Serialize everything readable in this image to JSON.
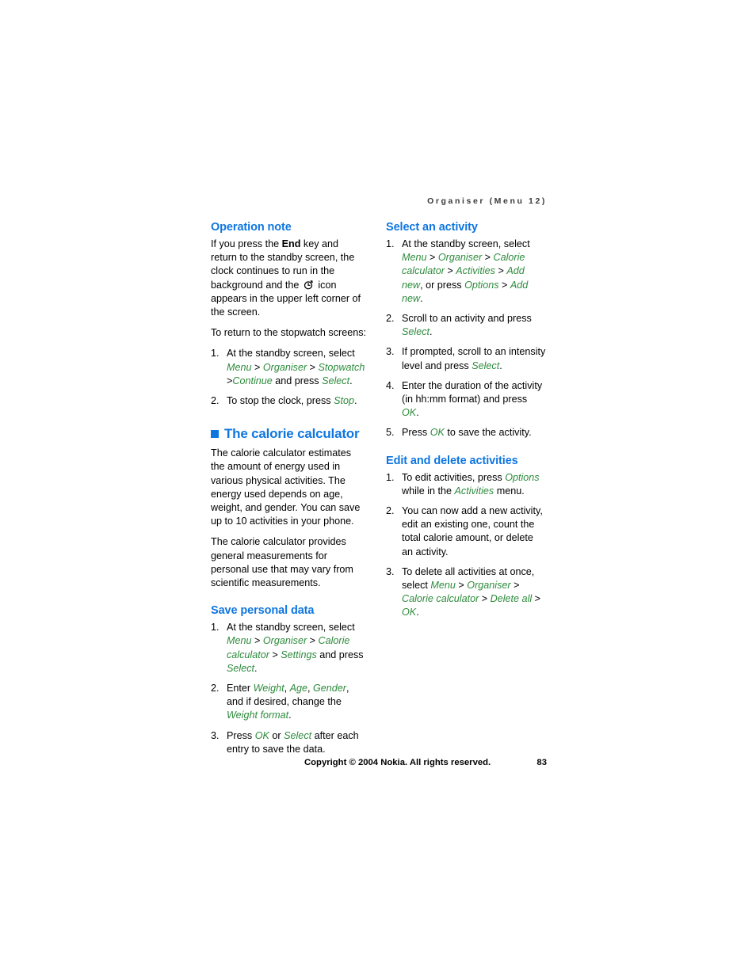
{
  "page": {
    "running_header": "Organiser (Menu 12)",
    "page_number": "83",
    "copyright": "Copyright © 2004 Nokia. All rights reserved.",
    "colors": {
      "heading_blue": "#0f76e0",
      "ui_term_green": "#2e8b3d",
      "body_black": "#000000",
      "header_gray": "#3a3a3a",
      "background": "#ffffff"
    }
  },
  "left_column": {
    "operation_note": {
      "heading": "Operation note",
      "paragraph_1": {
        "part_1": "If you press the ",
        "bold_key": "End",
        "part_2": " key and return to the standby screen, the clock continues to run in the background and the ",
        "icon": "stopwatch-icon",
        "part_3": " icon appears in the upper left corner of the screen."
      },
      "paragraph_2": "To return to the stopwatch screens:",
      "steps": [
        {
          "num": "1.",
          "seg_1": "At the standby screen, select ",
          "ui_1": "Menu",
          "sep_1": " > ",
          "ui_2": "Organiser",
          "sep_2": " > ",
          "ui_3": "Stopwatch",
          "sep_3": " >",
          "ui_4": "Continue",
          "seg_2": " and press ",
          "ui_5": "Select",
          "seg_3": "."
        },
        {
          "num": "2.",
          "seg_1": "To stop the clock, press ",
          "ui_1": "Stop",
          "seg_2": "."
        }
      ]
    },
    "calorie_calculator": {
      "heading": "The calorie calculator",
      "paragraph_1": "The calorie calculator estimates the amount of energy used in various physical activities. The energy used depends on age, weight, and gender. You can save up to 10 activities in your phone.",
      "paragraph_2": "The calorie calculator provides general measurements for personal use that may vary from scientific measurements."
    },
    "save_personal_data": {
      "heading": "Save personal data",
      "steps": [
        {
          "num": "1.",
          "seg_1": "At the standby screen, select ",
          "ui_1": "Menu",
          "sep_1": " > ",
          "ui_2": "Organiser",
          "sep_2": " > ",
          "ui_3": "Calorie calculator",
          "sep_3": " > ",
          "ui_4": "Settings",
          "seg_2": " and press ",
          "ui_5": "Select",
          "seg_3": "."
        },
        {
          "num": "2.",
          "seg_1": "Enter ",
          "ui_1": "Weight",
          "sep_1": ", ",
          "ui_2": "Age",
          "sep_2": ", ",
          "ui_3": "Gender",
          "seg_2": ", and if desired, change the ",
          "ui_4": "Weight format",
          "seg_3": "."
        },
        {
          "num": "3.",
          "seg_1": "Press ",
          "ui_1": "OK",
          "seg_2": " or ",
          "ui_2": "Select",
          "seg_3": " after each entry to save the data."
        }
      ]
    }
  },
  "right_column": {
    "select_an_activity": {
      "heading": "Select an activity",
      "steps": [
        {
          "num": "1.",
          "seg_1": "At the standby screen, select ",
          "ui_1": "Menu",
          "sep_1": " > ",
          "ui_2": "Organiser",
          "sep_2": " > ",
          "ui_3": "Calorie calculator",
          "sep_3": " > ",
          "ui_4": "Activities",
          "sep_4": " > ",
          "ui_5": "Add new",
          "seg_2": ", or press ",
          "ui_6": "Options",
          "sep_5": " > ",
          "ui_7": "Add new",
          "seg_3": "."
        },
        {
          "num": "2.",
          "seg_1": "Scroll to an activity and press ",
          "ui_1": "Select",
          "seg_2": "."
        },
        {
          "num": "3.",
          "seg_1": "If prompted, scroll to an intensity level and press ",
          "ui_1": "Select",
          "seg_2": "."
        },
        {
          "num": "4.",
          "seg_1": "Enter the duration of the activity (in hh:mm format) and press ",
          "ui_1": "OK",
          "seg_2": "."
        },
        {
          "num": "5.",
          "seg_1": "Press ",
          "ui_1": "OK",
          "seg_2": " to save the activity."
        }
      ]
    },
    "edit_and_delete_activities": {
      "heading": "Edit and delete activities",
      "steps": [
        {
          "num": "1.",
          "seg_1": "To edit activities, press ",
          "ui_1": "Options",
          "seg_2": " while in the ",
          "ui_2": "Activities",
          "seg_3": " menu."
        },
        {
          "num": "2.",
          "seg_1": "You can now add a new activity, edit an existing one, count the total calorie amount, or delete an activity."
        },
        {
          "num": "3.",
          "seg_1": "To delete all activities at once, select ",
          "ui_1": "Menu",
          "sep_1": " > ",
          "ui_2": "Organiser",
          "sep_2": " > ",
          "ui_3": "Calorie calculator",
          "sep_3": " > ",
          "ui_4": "Delete all",
          "sep_4": " > ",
          "ui_5": "OK",
          "seg_2": "."
        }
      ]
    }
  }
}
